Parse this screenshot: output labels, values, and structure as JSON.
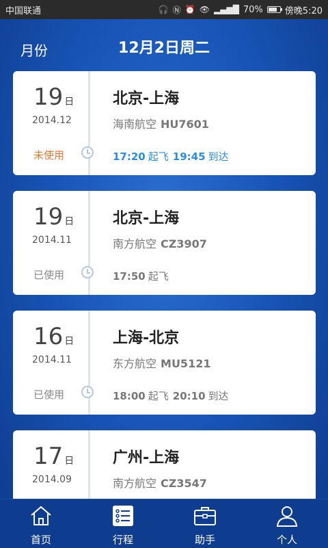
{
  "status_bar": {
    "carrier": "中国联通",
    "battery": "70%",
    "battery_level": 0.7,
    "time": "傍晚5:20"
  },
  "header": {
    "month_label": "月份",
    "date_title": "12月2日周二"
  },
  "trips": [
    {
      "day": "19",
      "day_unit": "日",
      "month": "2014.12",
      "status": "未使用",
      "route": "北京-上海",
      "airline": "海南航空",
      "flight_no": "HU7601",
      "depart_time": "17:20",
      "depart_label": "起飞",
      "arrive_time": "19:45",
      "arrive_label": "到达"
    },
    {
      "day": "19",
      "day_unit": "日",
      "month": "2014.11",
      "status": "已使用",
      "route": "北京-上海",
      "airline": "南方航空",
      "flight_no": "CZ3907",
      "depart_time": "17:50",
      "depart_label": "起飞"
    },
    {
      "day": "16",
      "day_unit": "日",
      "month": "2014.11",
      "status": "已使用",
      "route": "上海-北京",
      "airline": "东方航空",
      "flight_no": "MU5121",
      "depart_time": "18:00",
      "depart_label": "起飞",
      "arrive_time": "20:10",
      "arrive_label": "到达"
    },
    {
      "day": "17",
      "day_unit": "日",
      "month": "2014.09",
      "route": "广州-上海",
      "airline": "南方航空",
      "flight_no": "CZ3547"
    }
  ],
  "tabs": [
    {
      "label": "首页",
      "icon": "home-icon"
    },
    {
      "label": "行程",
      "icon": "itinerary-icon"
    },
    {
      "label": "助手",
      "icon": "briefcase-icon"
    },
    {
      "label": "个人",
      "icon": "person-icon"
    }
  ]
}
